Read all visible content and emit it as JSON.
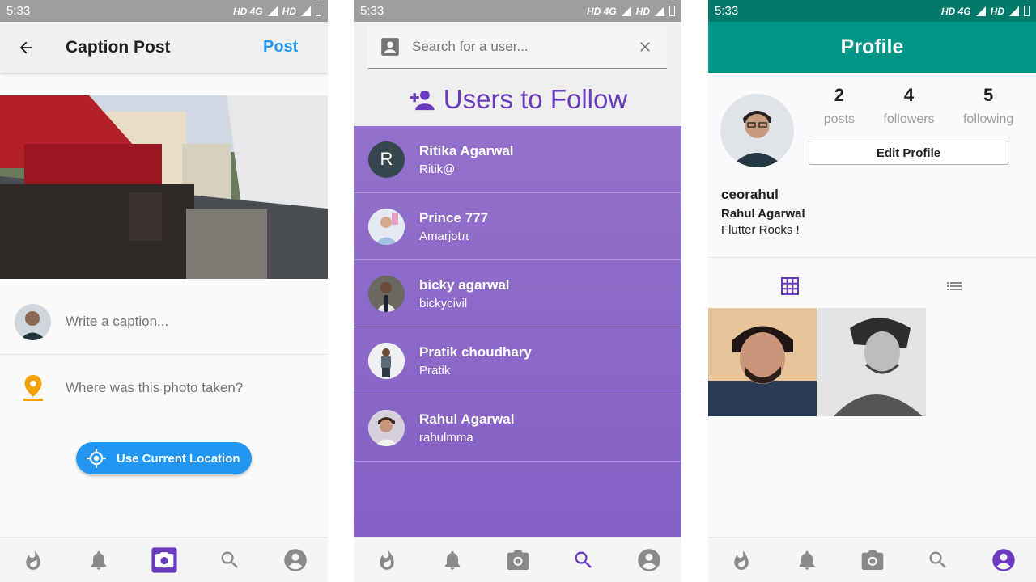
{
  "status": {
    "time": "5:33",
    "network_left": "HD 4G",
    "network_right": "HD",
    "network_mid": "HD 4G"
  },
  "caption_post": {
    "title": "Caption Post",
    "post_label": "Post",
    "caption_placeholder": "Write a caption...",
    "location_placeholder": "Where was this photo taken?",
    "use_location_label": "Use Current Location"
  },
  "search": {
    "placeholder": "Search for a user...",
    "header": "Users to Follow",
    "users": [
      {
        "name": "Ritika Agarwal",
        "handle": "Ritik@",
        "initial": "R"
      },
      {
        "name": "Prince 777",
        "handle": "Amarjotπ",
        "initial": ""
      },
      {
        "name": "bicky agarwal",
        "handle": "bickycivil",
        "initial": ""
      },
      {
        "name": "Pratik choudhary",
        "handle": "Pratik",
        "initial": ""
      },
      {
        "name": "Rahul Agarwal",
        "handle": "rahulmma",
        "initial": ""
      }
    ]
  },
  "profile": {
    "title": "Profile",
    "posts_count": "2",
    "posts_label": "posts",
    "followers_count": "4",
    "followers_label": "followers",
    "following_count": "5",
    "following_label": "following",
    "edit_label": "Edit Profile",
    "username": "ceorahul",
    "full_name": "Rahul Agarwal",
    "bio": "Flutter Rocks !"
  },
  "nav_icons": [
    "flame-icon",
    "bell-icon",
    "camera-icon",
    "search-icon",
    "account-icon"
  ],
  "colors": {
    "accent_purple": "#6a3bbf",
    "blue": "#2196f3",
    "teal": "#009688",
    "nav_gray": "#8a8a8a"
  }
}
